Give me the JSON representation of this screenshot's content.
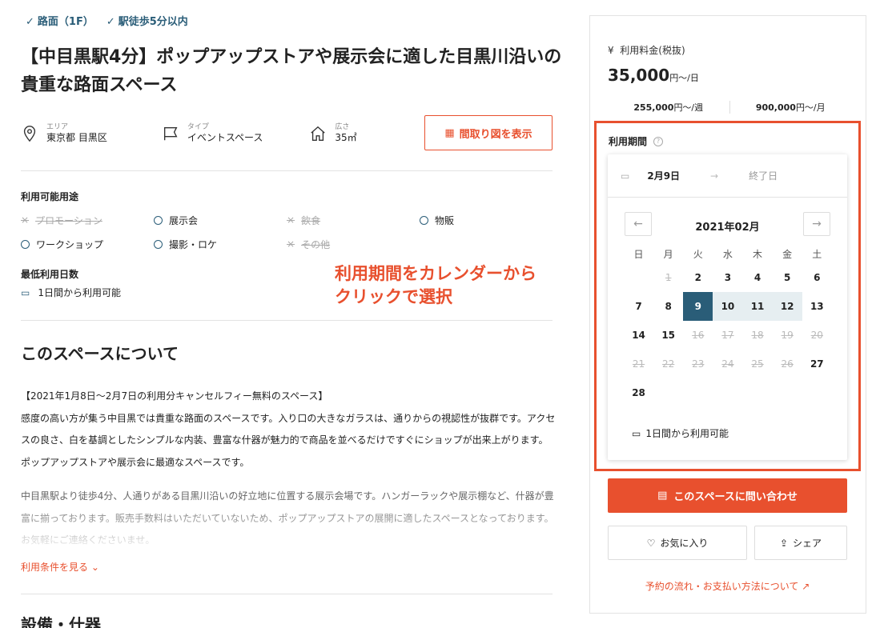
{
  "tags": [
    "路面（1F）",
    "駅徒歩5分以内"
  ],
  "title": "【中目黒駅4分】ポップアップストアや展示会に適した目黒川沿いの貴重な路面スペース",
  "meta": {
    "area_label": "エリア",
    "area": "東京都 目黒区",
    "type_label": "タイプ",
    "type": "イベントスペース",
    "size_label": "広さ",
    "size": "35㎡",
    "floor_plan_button": "間取り図を表示"
  },
  "uses": {
    "label": "利用可能用途",
    "items": [
      {
        "text": "プロモーション",
        "available": false
      },
      {
        "text": "展示会",
        "available": true
      },
      {
        "text": "飲食",
        "available": false
      },
      {
        "text": "物販",
        "available": true
      },
      {
        "text": "ワークショップ",
        "available": true
      },
      {
        "text": "撮影・ロケ",
        "available": true
      },
      {
        "text": "その他",
        "available": false
      }
    ]
  },
  "min_days": {
    "label": "最低利用日数",
    "value": "1日間から利用可能"
  },
  "annotation": {
    "line1": "利用期間をカレンダーから",
    "line2": "クリックで選択"
  },
  "about": {
    "title": "このスペースについて",
    "p1a": "【2021年1月8日〜2月7日の利用分キャンセルフィー無料のスペース】",
    "p1b": "感度の高い方が集う中目黒では貴重な路面のスペースです。入り口の大きなガラスは、通りからの視認性が抜群です。アクセスの良さ、白を基調としたシンプルな内装、豊富な什器が魅力的で商品を並べるだけですぐにショップが出来上がります。ポップアップストアや展示会に最適なスペースです。",
    "p2": "中目黒駅より徒歩4分、人通りがある目黒川沿いの好立地に位置する展示会場です。ハンガーラックや展示棚など、什器が豊富に揃っております。販売手数料はいただいていないため、ポップアップストアの展開に適したスペースとなっております。お気軽にご連絡くださいませ。",
    "see_more": "利用条件を見る"
  },
  "equipment_title": "設備・什器",
  "sidebar": {
    "price_label": "利用料金(税抜)",
    "price": "35,000",
    "price_unit": "円〜/日",
    "weekly": "255,000",
    "weekly_unit": "円〜/週",
    "monthly": "900,000",
    "monthly_unit": "円〜/月",
    "period_label": "利用期間",
    "start_date": "2月9日",
    "end_placeholder": "終了日",
    "month": "2021年02月",
    "weekdays": [
      "日",
      "月",
      "火",
      "水",
      "木",
      "金",
      "土"
    ],
    "calendar_footer": "1日間から利用可能",
    "inquire_button": "このスペースに問い合わせ",
    "favorite_button": "お気に入り",
    "share_button": "シェア",
    "flow_link": "予約の流れ・お支払い方法について"
  },
  "calendar": {
    "weeks": [
      [
        {
          "d": ""
        },
        {
          "d": "1",
          "s": "dis"
        },
        {
          "d": "2"
        },
        {
          "d": "3"
        },
        {
          "d": "4"
        },
        {
          "d": "5"
        },
        {
          "d": "6"
        }
      ],
      [
        {
          "d": "7"
        },
        {
          "d": "8"
        },
        {
          "d": "9",
          "s": "sel"
        },
        {
          "d": "10",
          "s": "rng"
        },
        {
          "d": "11",
          "s": "rng"
        },
        {
          "d": "12",
          "s": "rng"
        },
        {
          "d": "13"
        }
      ],
      [
        {
          "d": "14"
        },
        {
          "d": "15"
        },
        {
          "d": "16",
          "s": "dis"
        },
        {
          "d": "17",
          "s": "dis"
        },
        {
          "d": "18",
          "s": "dis"
        },
        {
          "d": "19",
          "s": "dis"
        },
        {
          "d": "20",
          "s": "dis"
        }
      ],
      [
        {
          "d": "21",
          "s": "dis"
        },
        {
          "d": "22",
          "s": "dis"
        },
        {
          "d": "23",
          "s": "dis"
        },
        {
          "d": "24",
          "s": "dis"
        },
        {
          "d": "25",
          "s": "dis"
        },
        {
          "d": "26",
          "s": "dis"
        },
        {
          "d": "27"
        }
      ],
      [
        {
          "d": "28"
        },
        {
          "d": ""
        },
        {
          "d": ""
        },
        {
          "d": ""
        },
        {
          "d": ""
        },
        {
          "d": ""
        },
        {
          "d": ""
        }
      ]
    ]
  },
  "colors": {
    "accent": "#e8502e",
    "navy": "#2a5d78"
  }
}
